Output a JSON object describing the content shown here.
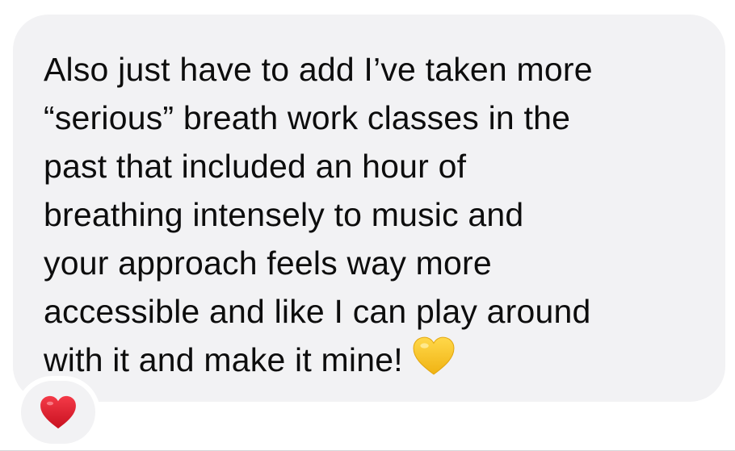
{
  "message": {
    "lines": [
      "Also just have to add I’ve taken more",
      "“serious” breath work classes in the",
      "past that included an hour of",
      "breathing intensely to music and",
      "your approach feels way more",
      "accessible and like I can play around",
      "with it and make it mine!"
    ],
    "trailing_emoji": "yellow-heart-icon"
  },
  "reaction": {
    "emoji": "red-heart-icon"
  },
  "colors": {
    "bubble": "#f2f2f4",
    "text": "#0d0d0d",
    "yellow_heart": "#f6c624",
    "red_heart": "#e0202e"
  }
}
